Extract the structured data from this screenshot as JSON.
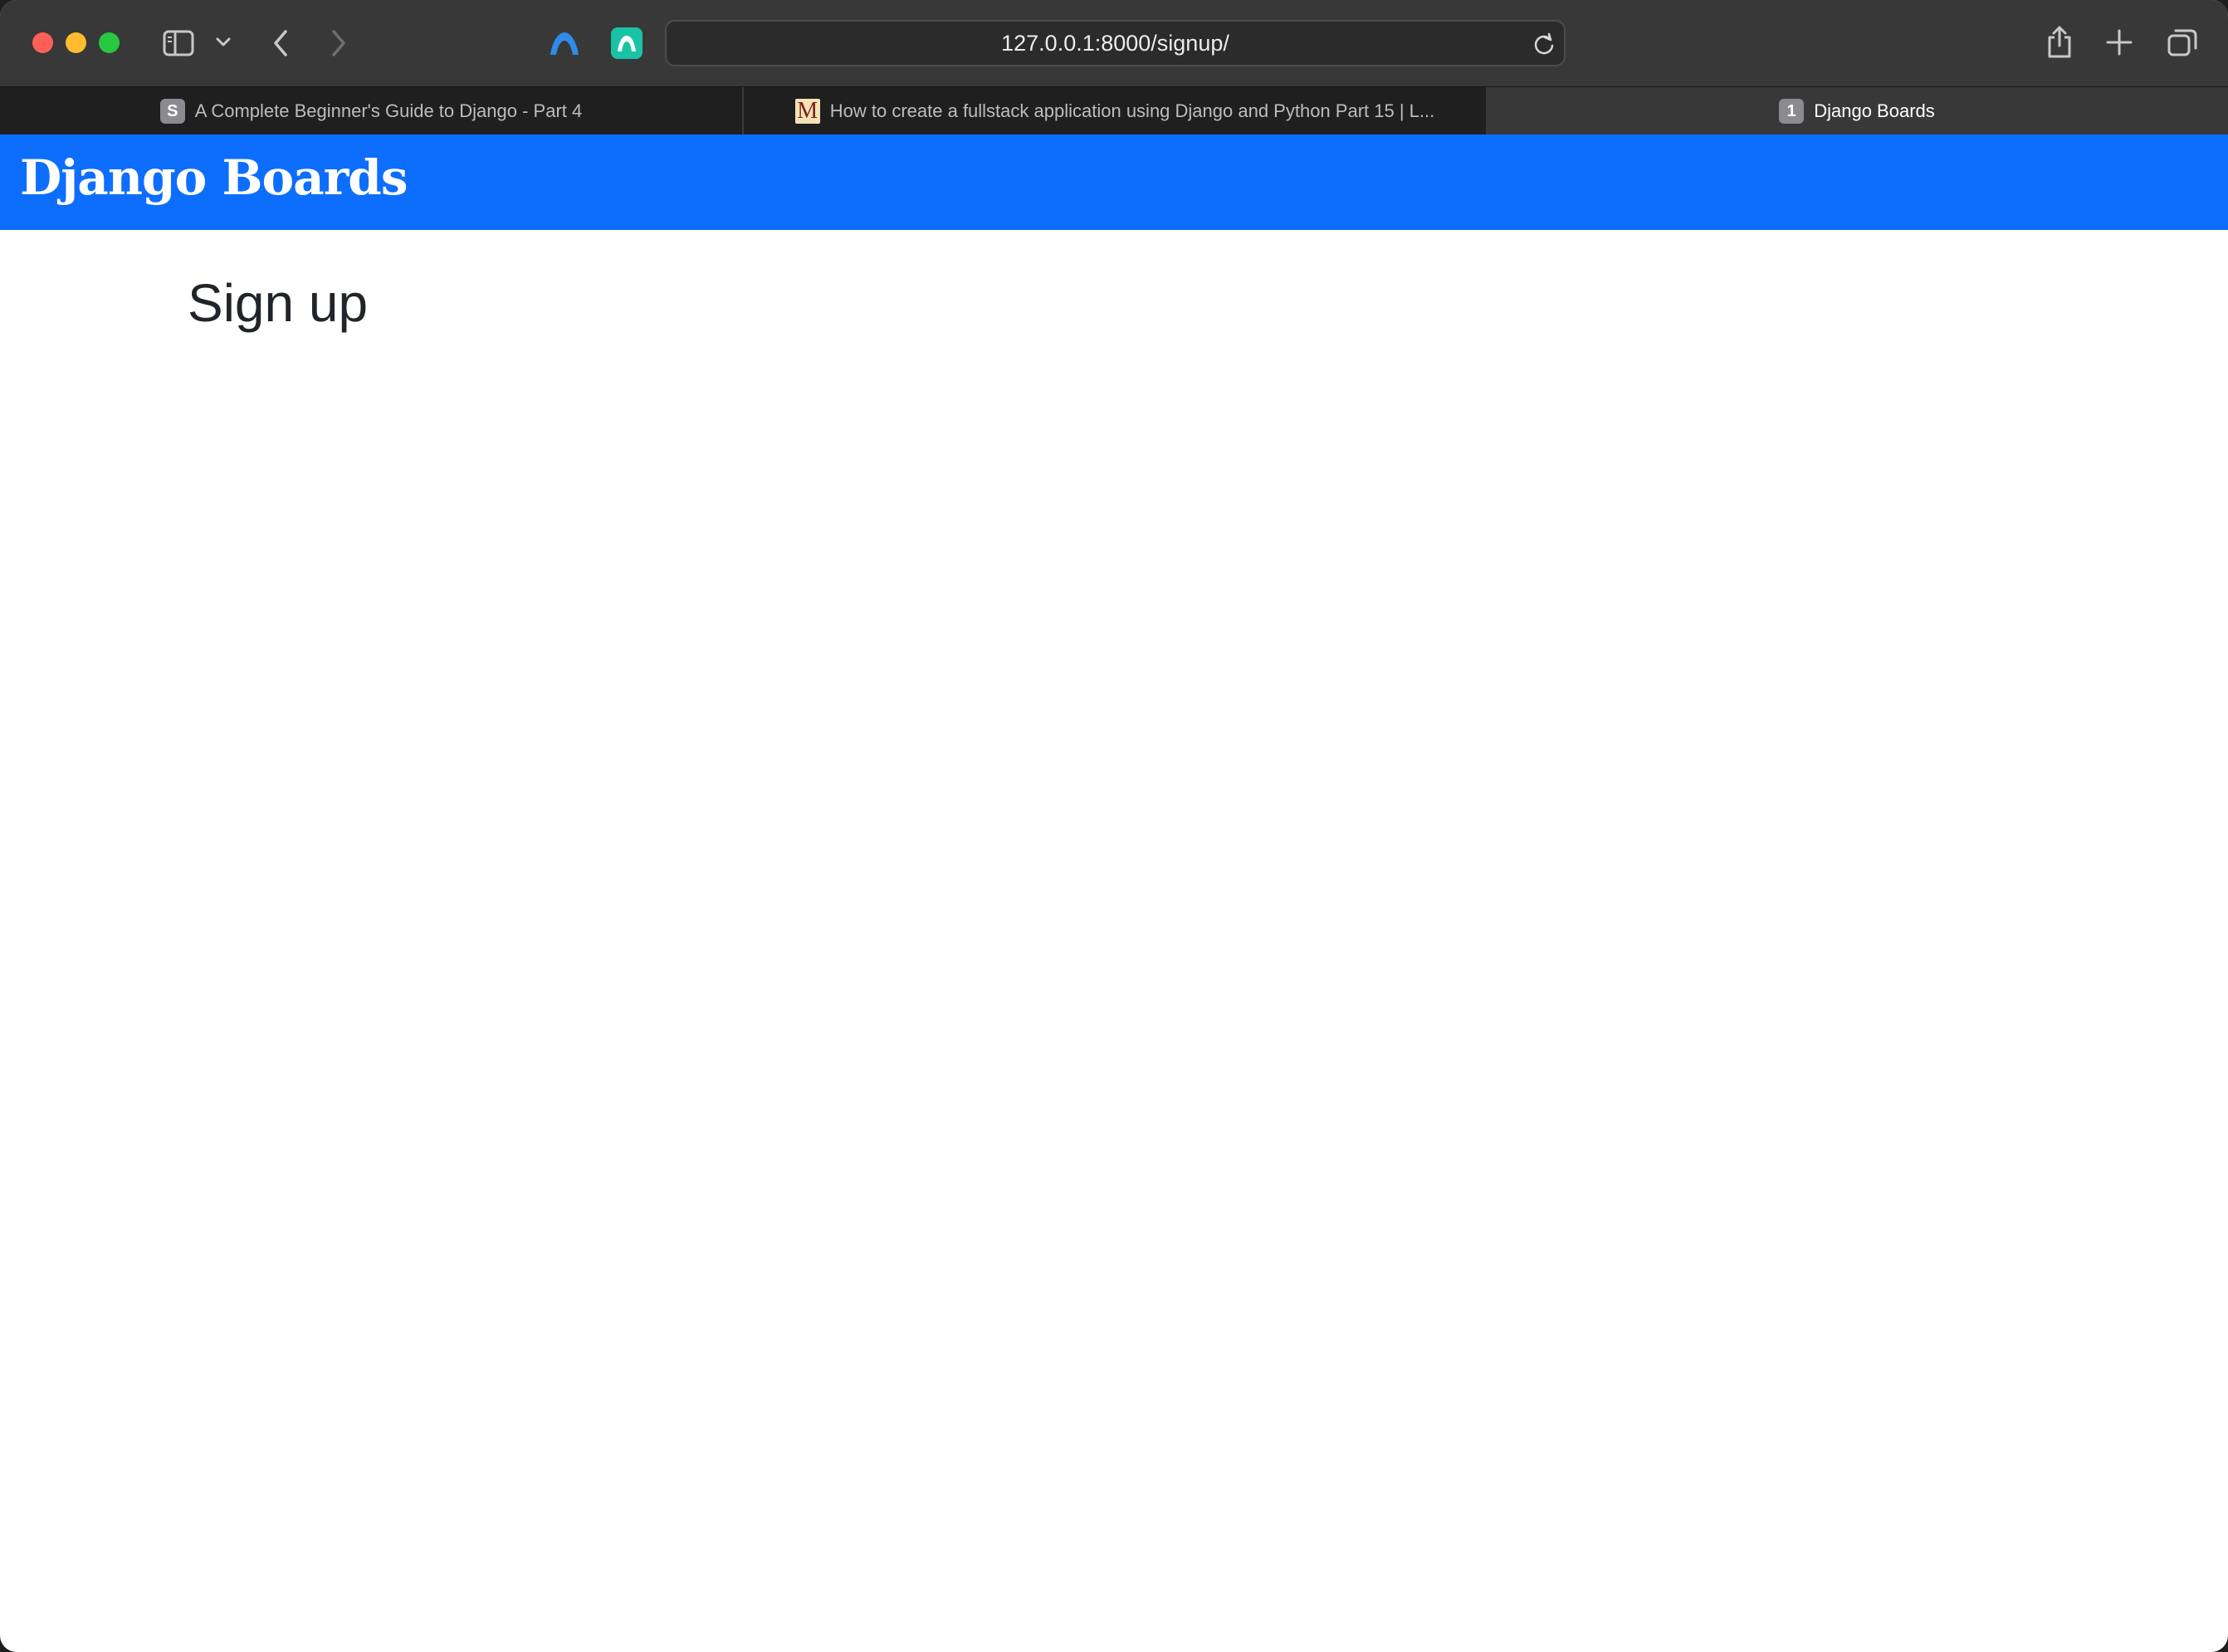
{
  "browser": {
    "url": "127.0.0.1:8000/signup/",
    "tabs": [
      {
        "label": "A Complete Beginner's Guide to Django - Part 4",
        "favicon": "S",
        "active": false
      },
      {
        "label": "How to create a fullstack application using Django and Python Part 15 | L...",
        "favicon": "M",
        "active": false
      },
      {
        "label": "Django Boards",
        "favicon": "1",
        "active": true
      }
    ],
    "toolbar_icons": [
      "sidebar-icon",
      "chevron-down-icon",
      "back-icon",
      "forward-icon",
      "extension-a-icon",
      "extension-b-icon",
      "reload-icon",
      "share-icon",
      "new-tab-icon",
      "tab-overview-icon"
    ]
  },
  "page": {
    "brand": "Django Boards",
    "heading": "Sign up"
  },
  "colors": {
    "navbar": "#0d6efd",
    "toolbar": "#383838",
    "tabbar": "#1f1f1f"
  }
}
